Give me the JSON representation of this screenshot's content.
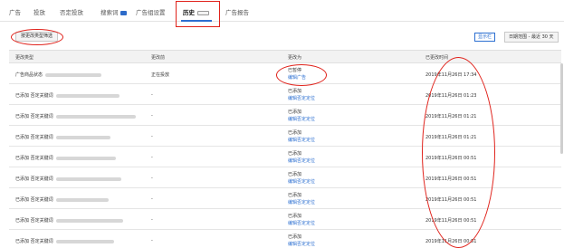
{
  "tabs": [
    {
      "label": "广告"
    },
    {
      "label": "投放"
    },
    {
      "label": "否定投放"
    },
    {
      "label": "搜索词"
    },
    {
      "label": "广告组设置"
    },
    {
      "label": "历史"
    },
    {
      "label": "广告报告"
    }
  ],
  "toolbar": {
    "filter_label": "按更改类型筛选",
    "columns_label": "显示栏",
    "date_range_label": "日期范围 - 最近 30 天"
  },
  "table": {
    "headers": [
      "更改类型",
      "更改前",
      "更改为",
      "已更改时间"
    ],
    "rows": [
      {
        "type": "广告商品状态",
        "from": "正在投放",
        "to": "已暂停",
        "to_link": "编辑广告",
        "time": "2019年11月26日 17:34"
      },
      {
        "type": "已添加 否定关键词",
        "from": "-",
        "to": "已添加",
        "to_link": "编辑否定定位",
        "time": "2019年11月26日 01:23"
      },
      {
        "type": "已添加 否定关键词",
        "from": "-",
        "to": "已添加",
        "to_link": "编辑否定定位",
        "time": "2019年11月26日 01:21"
      },
      {
        "type": "已添加 否定关键词",
        "from": "-",
        "to": "已添加",
        "to_link": "编辑否定定位",
        "time": "2019年11月26日 01:21"
      },
      {
        "type": "已添加 否定关键词",
        "from": "-",
        "to": "已添加",
        "to_link": "编辑否定定位",
        "time": "2019年11月26日 00:51"
      },
      {
        "type": "已添加 否定关键词",
        "from": "-",
        "to": "已添加",
        "to_link": "编辑否定定位",
        "time": "2019年11月26日 00:51"
      },
      {
        "type": "已添加 否定关键词",
        "from": "-",
        "to": "已添加",
        "to_link": "编辑否定定位",
        "time": "2019年11月26日 00:51"
      },
      {
        "type": "已添加 否定关键词",
        "from": "-",
        "to": "已添加",
        "to_link": "编辑否定定位",
        "time": "2019年11月26日 00:51"
      },
      {
        "type": "已添加 否定关键词",
        "from": "-",
        "to": "已添加",
        "to_link": "编辑否定定位",
        "time": "2019年11月26日 00:51"
      }
    ]
  },
  "colors": {
    "accent": "#2c6fd1",
    "annotation": "#e0221b"
  }
}
